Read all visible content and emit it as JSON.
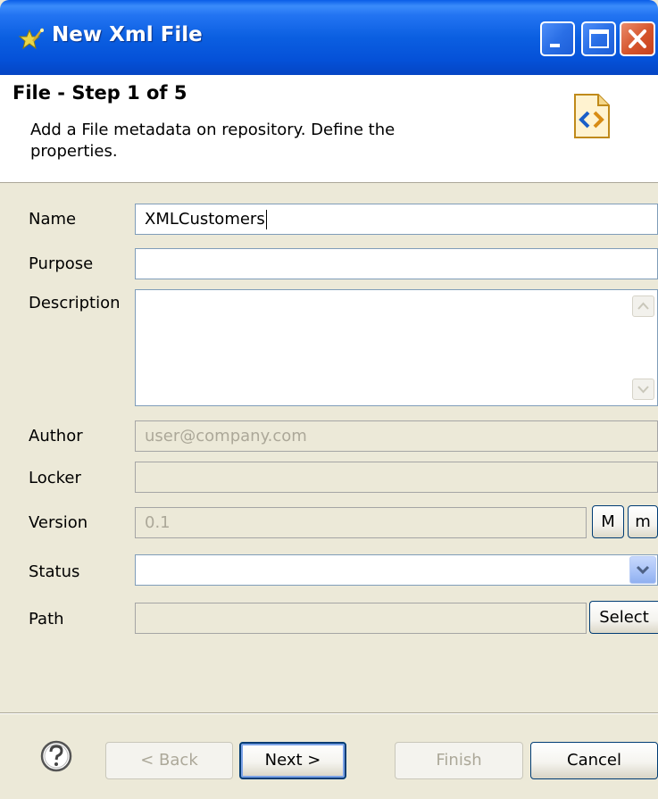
{
  "window": {
    "title": "New Xml File",
    "icon": "wizard-star-icon",
    "controls": [
      "minimize-icon",
      "maximize-icon",
      "close-icon"
    ]
  },
  "header": {
    "step_title": "File - Step 1 of 5",
    "description": "Add a File metadata on repository. Define the properties.",
    "icon": "xml-file-icon"
  },
  "form": {
    "name_label": "Name",
    "name_value": "XMLCustomers",
    "purpose_label": "Purpose",
    "purpose_value": "",
    "description_label": "Description",
    "description_value": "",
    "author_label": "Author",
    "author_value": "user@company.com",
    "locker_label": "Locker",
    "locker_value": "",
    "version_label": "Version",
    "version_value": "0.1",
    "major_button": "M",
    "minor_button": "m",
    "status_label": "Status",
    "status_value": "",
    "path_label": "Path",
    "path_value": "",
    "select_button": "Select"
  },
  "buttons": {
    "help_icon": "help-icon",
    "back": "< Back",
    "next": "Next >",
    "finish": "Finish",
    "cancel": "Cancel"
  },
  "colors": {
    "titlebar": "#0a5ee8",
    "window_bg": "#ece9d8",
    "close_button": "#d5542b"
  }
}
